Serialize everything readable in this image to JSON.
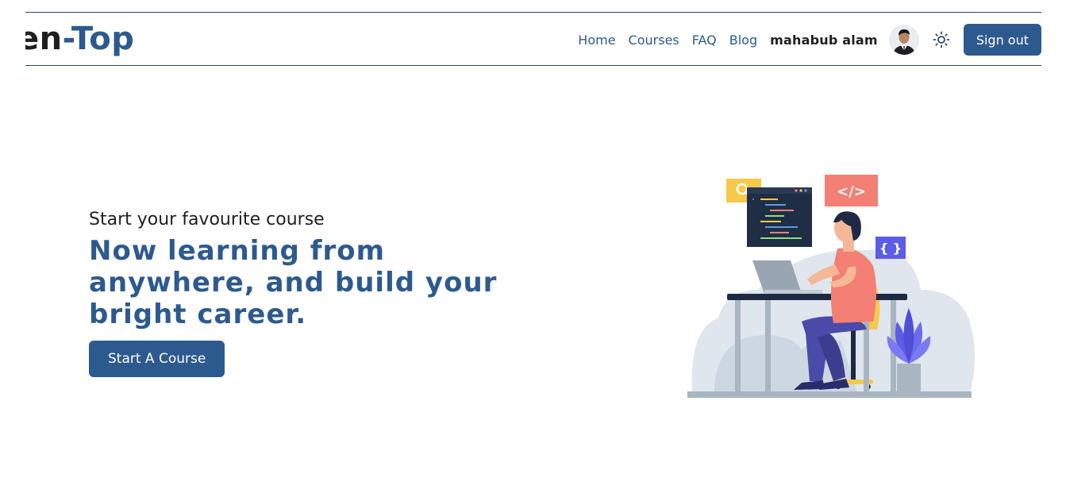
{
  "brand": {
    "logo_part_a": "en",
    "logo_part_b": "-Top"
  },
  "nav": {
    "links": [
      "Home",
      "Courses",
      "FAQ",
      "Blog"
    ],
    "user_name": "mahabub alam",
    "signout_label": "Sign out"
  },
  "hero": {
    "subtitle": "Start your favourite course",
    "title": "Now learning from anywhere, and build your bright career.",
    "cta_label": "Start A Course"
  },
  "illustration": {
    "code_tag": "</>",
    "braces_tag": "{ }",
    "icons": [
      "search-icon",
      "code-window-icon",
      "laptop-icon",
      "plant-icon"
    ]
  },
  "colors": {
    "primary": "#2d5a8e",
    "text_dark": "#1f1f1f",
    "nav_border": "#2d4a68",
    "accent_red": "#f47f74",
    "accent_yellow": "#f7c94b",
    "accent_purple": "#5c5ce6"
  }
}
